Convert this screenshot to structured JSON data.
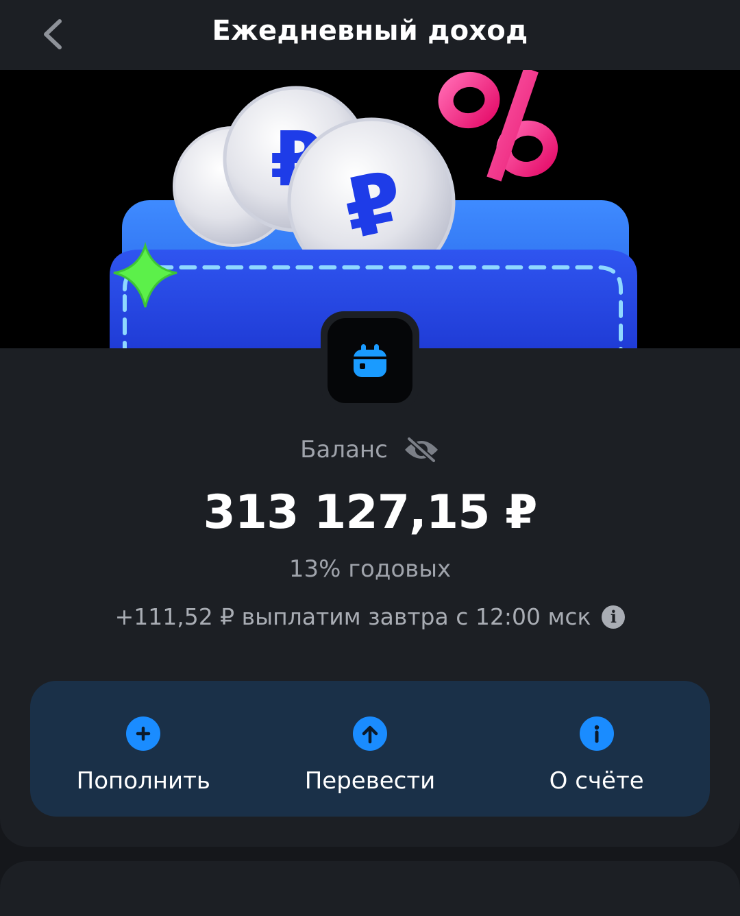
{
  "header": {
    "title": "Ежедневный доход",
    "back_icon": "chevron-left-icon"
  },
  "hero": {
    "illustration": "wallet-with-ruble-coins-and-percent",
    "percent_symbol": "%",
    "ruble_symbol": "₽"
  },
  "account": {
    "icon": "calendar-icon",
    "balance_label": "Баланс",
    "visibility_icon": "eye-off-icon",
    "amount": "313 127,15 ₽",
    "rate": "13% годовых",
    "payout": "+111,52 ₽ выплатим завтра с 12:00 мск",
    "payout_info_icon": "info-icon"
  },
  "actions": [
    {
      "label": "Пополнить",
      "icon": "plus-circle-icon"
    },
    {
      "label": "Перевести",
      "icon": "arrow-up-circle-icon"
    },
    {
      "label": "О счёте",
      "icon": "info-circle-icon"
    }
  ],
  "colors": {
    "background": "#15171b",
    "surface": "#1c1f24",
    "actions_panel": "#1a3048",
    "accent": "#1a8cff",
    "wallet_blue": "#2a4fe8",
    "percent_pink": "#ff2e8a",
    "star_green": "#5cf04a",
    "muted_text": "#9fa3ab"
  }
}
